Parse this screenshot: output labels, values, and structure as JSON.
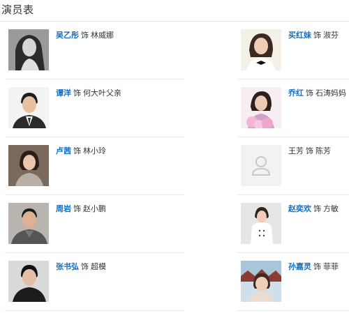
{
  "section": {
    "title": "演员表"
  },
  "as_word": "饰",
  "cast": [
    {
      "actor": "吴乙彤",
      "role": "林威娜",
      "linked": true,
      "photo_icon": "actor-photo"
    },
    {
      "actor": "买红妹",
      "role": "淑芬",
      "linked": true,
      "photo_icon": "actor-photo"
    },
    {
      "actor": "谭洋",
      "role": "何大叶父亲",
      "linked": true,
      "photo_icon": "actor-photo"
    },
    {
      "actor": "乔红",
      "role": "石涛妈妈",
      "linked": true,
      "photo_icon": "actor-photo"
    },
    {
      "actor": "卢茜",
      "role": "林小玲",
      "linked": true,
      "photo_icon": "actor-photo"
    },
    {
      "actor": "王芳",
      "role": "陈芳",
      "linked": false,
      "photo_icon": "user-placeholder-icon"
    },
    {
      "actor": "周岩",
      "role": "赵小鹏",
      "linked": true,
      "photo_icon": "actor-photo"
    },
    {
      "actor": "赵奕欢",
      "role": "方敏",
      "linked": true,
      "photo_icon": "actor-photo"
    },
    {
      "actor": "张书弘",
      "role": "超模",
      "linked": true,
      "photo_icon": "actor-photo"
    },
    {
      "actor": "孙嘉灵",
      "role": "菲菲",
      "linked": true,
      "photo_icon": "actor-photo"
    }
  ],
  "colors": {
    "link": "#136ec2",
    "text": "#333333",
    "divider": "#ececec",
    "placeholder_bg": "#f2f2f2",
    "placeholder_icon": "#c8c8c8"
  }
}
